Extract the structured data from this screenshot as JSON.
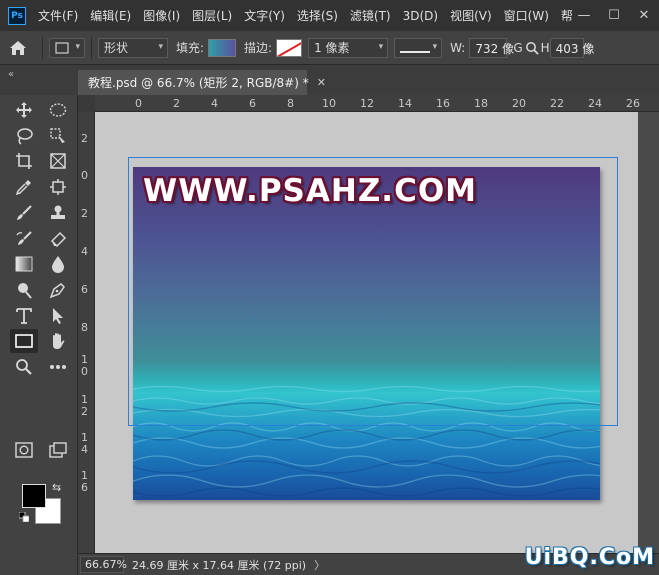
{
  "menubar": {
    "logo": "Ps",
    "items": [
      "文件(F)",
      "编辑(E)",
      "图像(I)",
      "图层(L)",
      "文字(Y)",
      "选择(S)",
      "滤镜(T)",
      "3D(D)",
      "视图(V)",
      "窗口(W)",
      "帮"
    ],
    "window_controls": [
      "—",
      "☐",
      "✕"
    ]
  },
  "options": {
    "mode": "形状",
    "fill_label": "填充:",
    "stroke_label": "描边:",
    "stroke_width": "1 像素",
    "w_label": "W:",
    "w_value": "732 像",
    "g_label": "G",
    "h_value": "403 像"
  },
  "tab": {
    "title": "教程.psd @ 66.7% (矩形 2, RGB/8#) *",
    "close": "✕",
    "collapse": "«"
  },
  "ruler_top": [
    "2",
    "0",
    "2",
    "4",
    "6",
    "8",
    "10",
    "12",
    "14",
    "16",
    "18",
    "20",
    "22",
    "24",
    "26"
  ],
  "ruler_left": [
    "2",
    "0",
    "2",
    "4",
    "6",
    "8",
    "1\n0",
    "1\n2",
    "1\n4",
    "1\n6"
  ],
  "document": {
    "text": "WWW.PSAHZ.COM"
  },
  "status": {
    "zoom": "66.67%",
    "info": "24.69 厘米 x 17.64 厘米 (72 ppi)",
    "arrow": "〉"
  },
  "watermark": "UiBQ.CoM",
  "colors": {
    "selection": "#2d7fdb",
    "foreground": "#000000",
    "background": "#ffffff"
  },
  "tools": [
    "move-icon",
    "marquee-icon",
    "lasso-icon",
    "quick-select-icon",
    "crop-icon",
    "frame-icon",
    "eyedropper-icon",
    "healing-icon",
    "brush-icon",
    "stamp-icon",
    "history-brush-icon",
    "eraser-icon",
    "gradient-icon",
    "blur-icon",
    "dodge-icon",
    "pen-icon",
    "type-icon",
    "path-select-icon",
    "rectangle-icon",
    "hand-icon",
    "zoom-icon",
    "more-icon"
  ]
}
